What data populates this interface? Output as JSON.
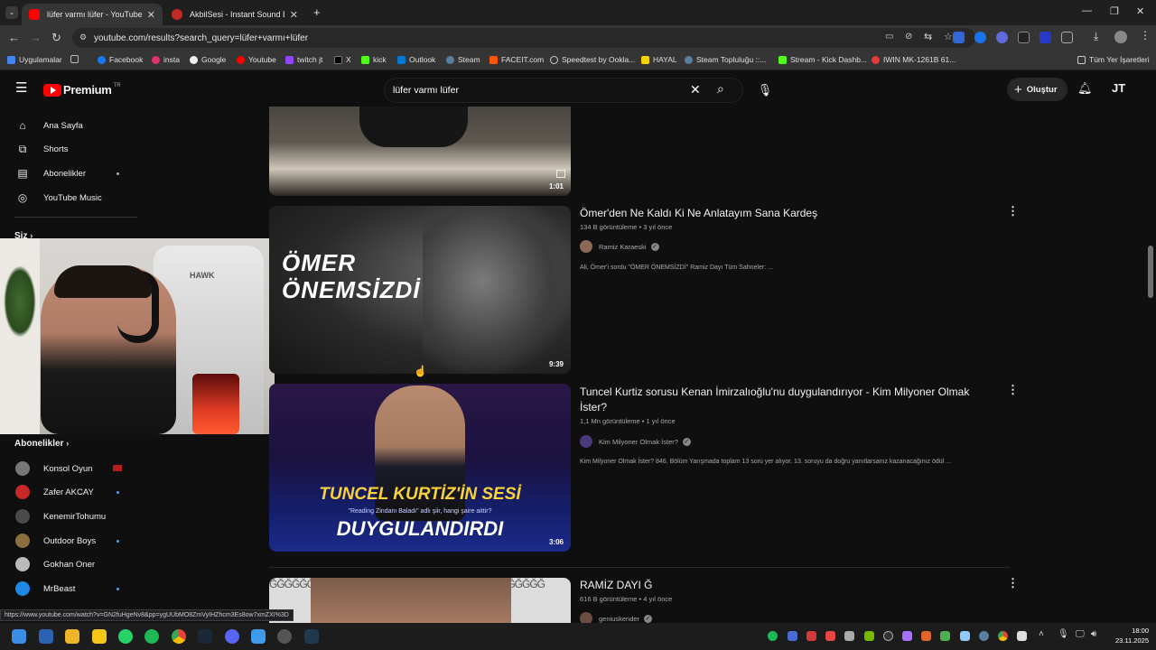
{
  "browser": {
    "tabs": [
      {
        "title": "lüfer varmı lüfer - YouTube",
        "active": true
      },
      {
        "title": "AkbilSesi - Instant Sound Effect",
        "active": false
      }
    ],
    "url": "youtube.com/results?search_query=lüfer+varmı+lüfer",
    "bookmarks": [
      "Uygulamalar",
      "Facebook",
      "insta",
      "Google",
      "Youtube",
      "twitch jt",
      "X",
      "kick",
      "Outlook",
      "Steam",
      "FACEIT.com",
      "Speedtest by Ookla...",
      "HAYAL",
      "Steam Topluluğu ::...",
      "Stream - Kick Dashb...",
      "IWIN MK-1261B 61..."
    ],
    "all_bookmarks": "Tüm Yer İşaretleri",
    "status_url": "https://www.youtube.com/watch?v=GN2fuHgeNv8&pp=ygUUbMO8ZmVyIHZhcm3Es8ow7xmZXI%3D"
  },
  "youtube": {
    "logo": "Premium",
    "logo_region": "TR",
    "search_value": "lüfer varmı lüfer",
    "create_label": "Oluştur",
    "profile_initials": "JT",
    "sidebar": {
      "main": [
        "Ana Sayfa",
        "Shorts",
        "Abonelikler",
        "YouTube Music"
      ],
      "siz": "Siz",
      "subs_header": "Abonelikler",
      "subs": [
        "Konsol Oyun",
        "Zafer AKCAY",
        "KenemirTohumu",
        "Outdoor Boys",
        "Gokhan Oner",
        "MrBeast"
      ]
    },
    "results": [
      {
        "duration": "1:01"
      },
      {
        "title": "Ömer'den Ne Kaldı Ki Ne Anlatayım Sana Kardeş",
        "views": "134 B görüntüleme",
        "age": "3 yıl önce",
        "channel": "Ramiz Karaeski",
        "desc": "Ali, Ömer'i sordu \"ÖMER ÖNEMSİZDİ\" Ramiz Dayı Tüm Sahneler: ...",
        "duration": "9:39",
        "thumb_text1": "ÖMER",
        "thumb_text2": "ÖNEMSİZDİ"
      },
      {
        "title": "Tuncel Kurtiz sorusu Kenan İmirzalıoğlu'nu duygulandırıyor - Kim Milyoner Olmak İster?",
        "views": "1,1 Mn görüntüleme",
        "age": "1 yıl önce",
        "channel": "Kim Milyoner Olmak İster?",
        "desc": "Kim Milyoner Olmak İster? 846. Bölüm Yarışmada toplam 13 soru yer alıyor. 13. soruyu da doğru yanıtlarsanız kazanacağınız ödül ...",
        "duration": "3:06",
        "thumb_text1": "TUNCEL KURTİZ'İN SESİ",
        "thumb_text2": "DUYGULANDIRDI",
        "thumb_sub": "\"Reading Zindanı Baladı\" adlı şiir, hangi şaire aittir?"
      },
      {
        "title": "RAMİZ DAYI Ğ",
        "views": "616 B görüntüleme",
        "age": "4 yıl önce",
        "channel": "geniuskender",
        "thumb_text": "ĞĞĞĞĞĞĞĞĞ"
      }
    ]
  },
  "taskbar": {
    "time": "18:00",
    "date": "23.11.2025"
  },
  "colors": {
    "yt_red": "#ff0000",
    "bg": "#0f0f0f",
    "link_blue": "#3ea6ff"
  }
}
